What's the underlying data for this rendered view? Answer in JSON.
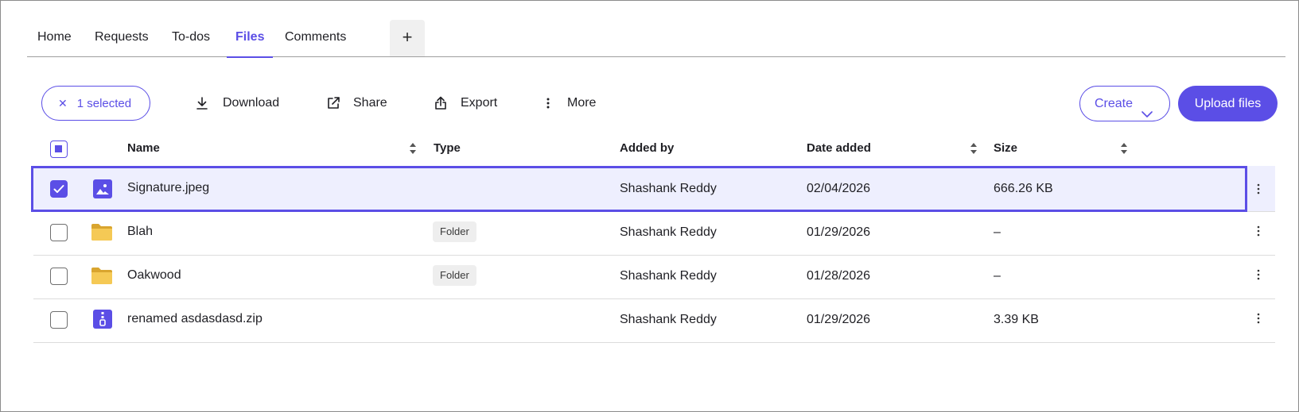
{
  "tabs": [
    {
      "label": "Home"
    },
    {
      "label": "Requests"
    },
    {
      "label": "To-dos"
    },
    {
      "label": "Files",
      "active": true
    },
    {
      "label": "Comments"
    }
  ],
  "tab_add_label": "+",
  "toolbar": {
    "selected_label": "1 selected",
    "download_label": "Download",
    "share_label": "Share",
    "export_label": "Export",
    "more_label": "More",
    "create_label": "Create",
    "upload_label": "Upload files"
  },
  "table": {
    "headers": {
      "name": "Name",
      "type": "Type",
      "added_by": "Added by",
      "date_added": "Date added",
      "size": "Size"
    },
    "rows": [
      {
        "name": "Signature.jpeg",
        "type": "",
        "added_by": "Shashank Reddy",
        "date_added": "02/04/2026",
        "size": "666.26 KB",
        "icon": "image-file-icon",
        "selected": true
      },
      {
        "name": "Blah",
        "type": "Folder",
        "added_by": "Shashank Reddy",
        "date_added": "01/29/2026",
        "size": "–",
        "icon": "folder-icon",
        "selected": false
      },
      {
        "name": "Oakwood",
        "type": "Folder",
        "added_by": "Shashank Reddy",
        "date_added": "01/28/2026",
        "size": "–",
        "icon": "folder-icon",
        "selected": false
      },
      {
        "name": "renamed asdasdasd.zip",
        "type": "",
        "added_by": "Shashank Reddy",
        "date_added": "01/29/2026",
        "size": "3.39 KB",
        "icon": "zip-file-icon",
        "selected": false
      }
    ]
  },
  "colors": {
    "accent": "#5b4ee6",
    "selected_row_bg": "#eeeffe",
    "folder": "#f2c14e"
  }
}
